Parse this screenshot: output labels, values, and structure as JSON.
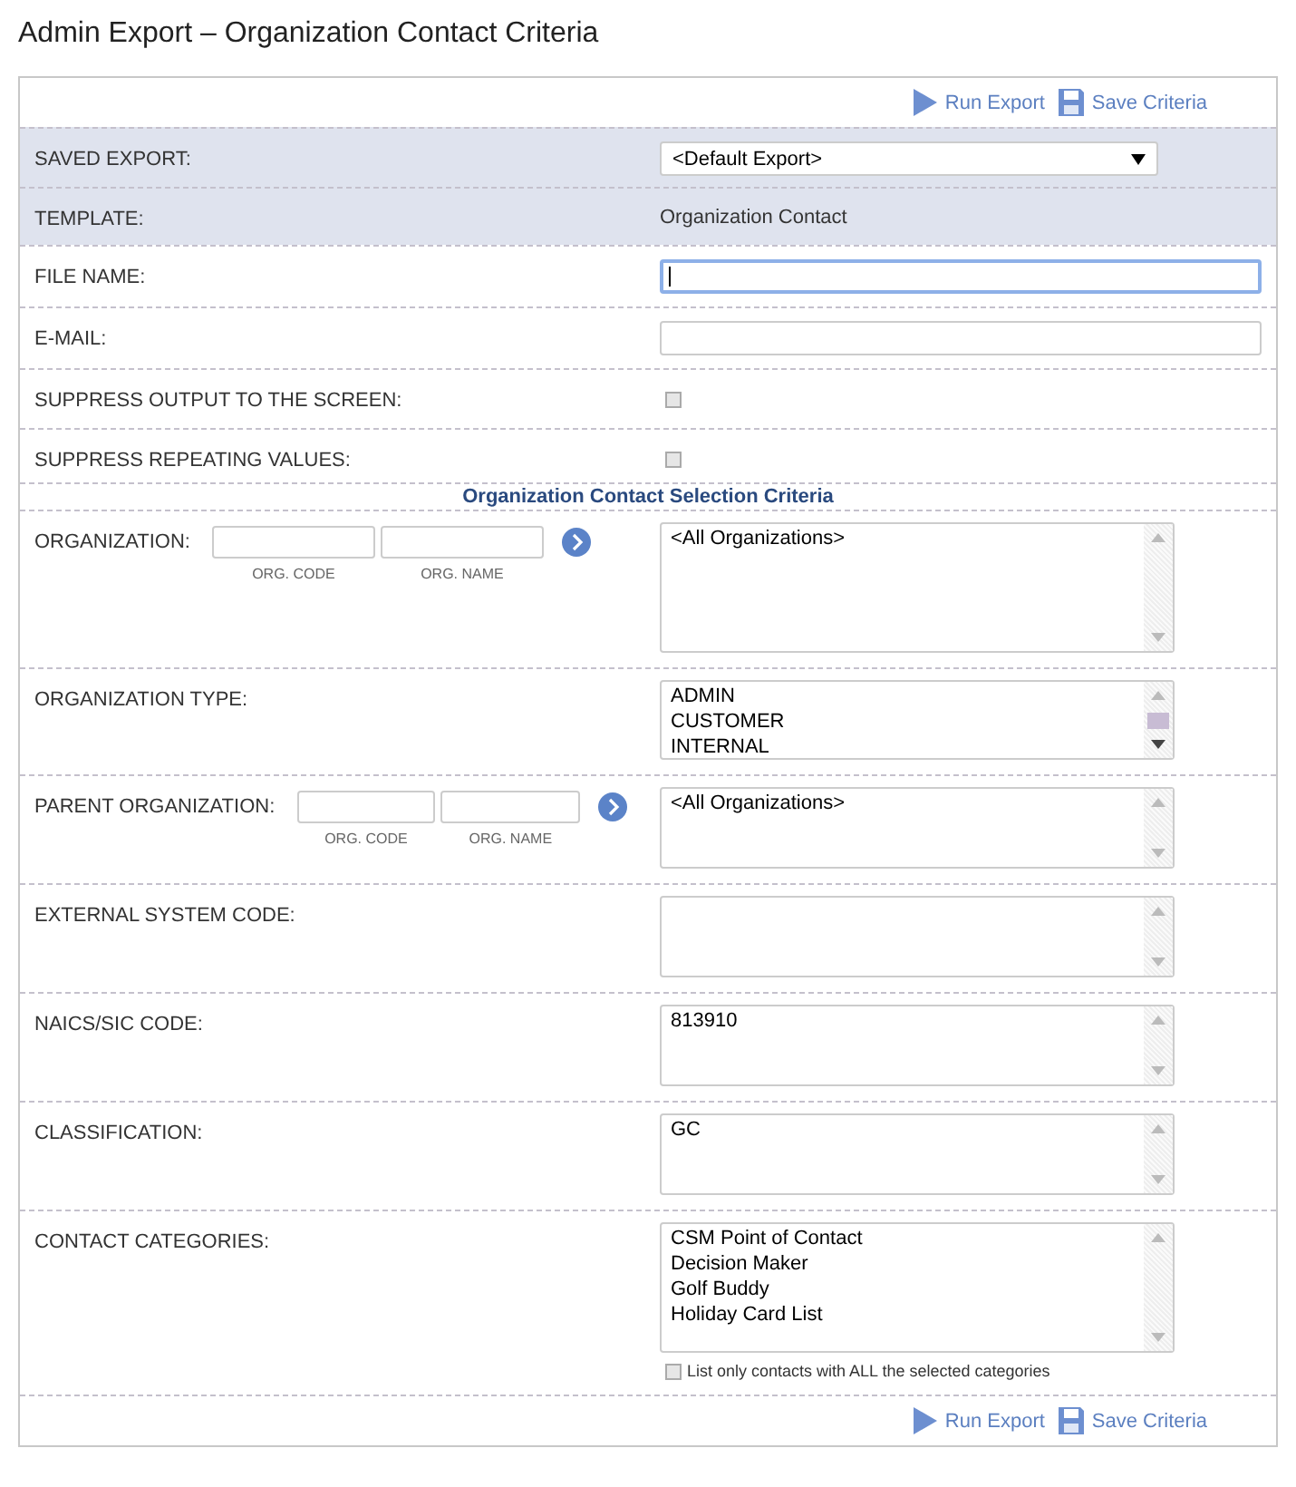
{
  "title": "Admin Export – Organization Contact Criteria",
  "top_toolbar": [
    {
      "kind": "run",
      "label": "Run Export"
    },
    {
      "kind": "save",
      "label": "Save Criteria"
    }
  ],
  "rows": [
    {
      "kind": "select",
      "label": "SAVED EXPORT:",
      "value": "<Default Export>",
      "shaded": true
    },
    {
      "kind": "text",
      "label": "TEMPLATE:",
      "value": "Organization Contact",
      "shaded": true
    },
    {
      "kind": "input",
      "label": "FILE NAME:",
      "focused": true
    },
    {
      "kind": "input",
      "label": "E-MAIL:",
      "focused": false
    },
    {
      "kind": "checkbox",
      "label": "SUPPRESS OUTPUT TO THE SCREEN:",
      "checked": false
    },
    {
      "kind": "checkbox",
      "label": "SUPPRESS REPEATING VALUES:",
      "checked": false
    },
    {
      "kind": "heading",
      "label": "Organization Contact Selection Criteria"
    },
    {
      "kind": "list",
      "label": "ORGANIZATION:",
      "lookup": [
        "ORG. CODE",
        "ORG. NAME"
      ],
      "items": [
        "<All Organizations>"
      ],
      "scrollable": false
    },
    {
      "kind": "list",
      "label": "ORGANIZATION TYPE:",
      "items": [
        "ADMIN",
        "CUSTOMER",
        "INTERNAL"
      ],
      "scrollable": true
    },
    {
      "kind": "list",
      "label": "PARENT ORGANIZATION:",
      "lookup": [
        "ORG. CODE",
        "ORG. NAME"
      ],
      "items": [
        "<All Organizations>"
      ],
      "scrollable": false
    },
    {
      "kind": "list",
      "label": "EXTERNAL SYSTEM CODE:",
      "scrollable": false
    },
    {
      "kind": "list",
      "label": "NAICS/SIC CODE:",
      "items": [
        "813910"
      ],
      "scrollable": false
    },
    {
      "kind": "list",
      "label": "CLASSIFICATION:",
      "items": [
        "GC"
      ],
      "scrollable": false
    },
    {
      "kind": "list",
      "label": "CONTACT CATEGORIES:",
      "items": [
        "CSM Point of Contact",
        "Decision Maker",
        "Golf Buddy",
        "Holiday Card List"
      ],
      "scrollable": false,
      "option": {
        "label": "List only contacts with ALL the selected categories",
        "checked": false
      }
    }
  ],
  "bottom_toolbar": [
    {
      "kind": "run",
      "label": "Run Export"
    },
    {
      "kind": "save",
      "label": "Save Criteria"
    }
  ]
}
